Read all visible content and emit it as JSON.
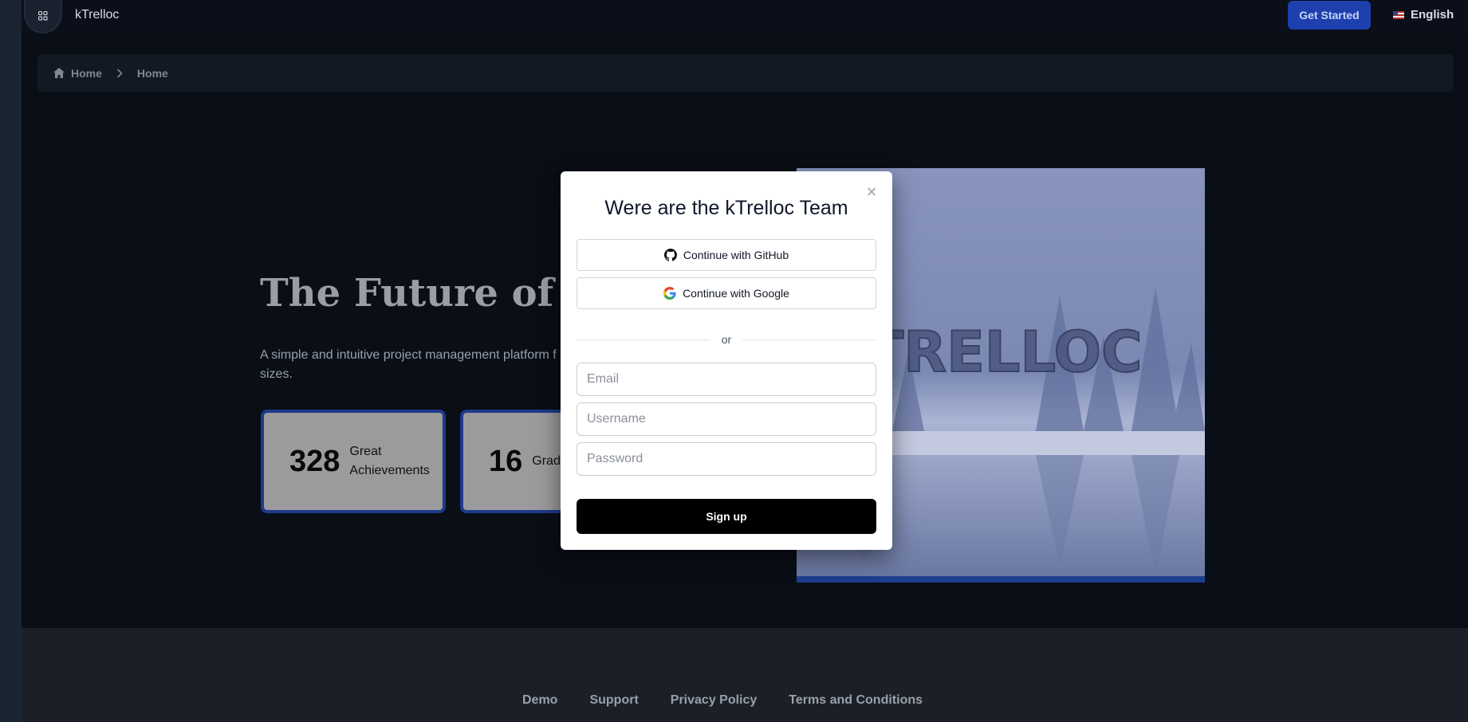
{
  "app": {
    "brand": "kTrelloc"
  },
  "header": {
    "menu_icon": "grid-icon",
    "get_started_label": "Get Started",
    "language_label": "English",
    "language_flag_icon": "us-flag-icon"
  },
  "breadcrumb": {
    "items": [
      "Home",
      "Home"
    ],
    "home_icon": "home-icon",
    "separator_icon": "chevron-right-icon"
  },
  "hero": {
    "title": "The Future of Tr",
    "subtitle_line1": "A simple and intuitive project management platform f",
    "subtitle_line2": "sizes.",
    "stats": [
      {
        "value": "328",
        "label": "Great Achievements"
      },
      {
        "value": "16",
        "label": "Grad Spon"
      }
    ],
    "image_text": "TRELLOC"
  },
  "modal": {
    "title": "Were are the kTrelloc Team",
    "github_label": "Continue with GitHub",
    "google_label": "Continue with Google",
    "divider_text": "or",
    "email_placeholder": "Email",
    "username_placeholder": "Username",
    "password_placeholder": "Password",
    "signup_label": "Sign up",
    "close_icon": "close-icon"
  },
  "footer": {
    "links": [
      "Demo",
      "Support",
      "Privacy Policy",
      "Terms and Conditions"
    ]
  },
  "colors": {
    "background": "#090e17",
    "accent": "#1e40af",
    "card_border": "#1e3a8a",
    "modal_bg": "#ffffff",
    "signup_bg": "#000000"
  }
}
